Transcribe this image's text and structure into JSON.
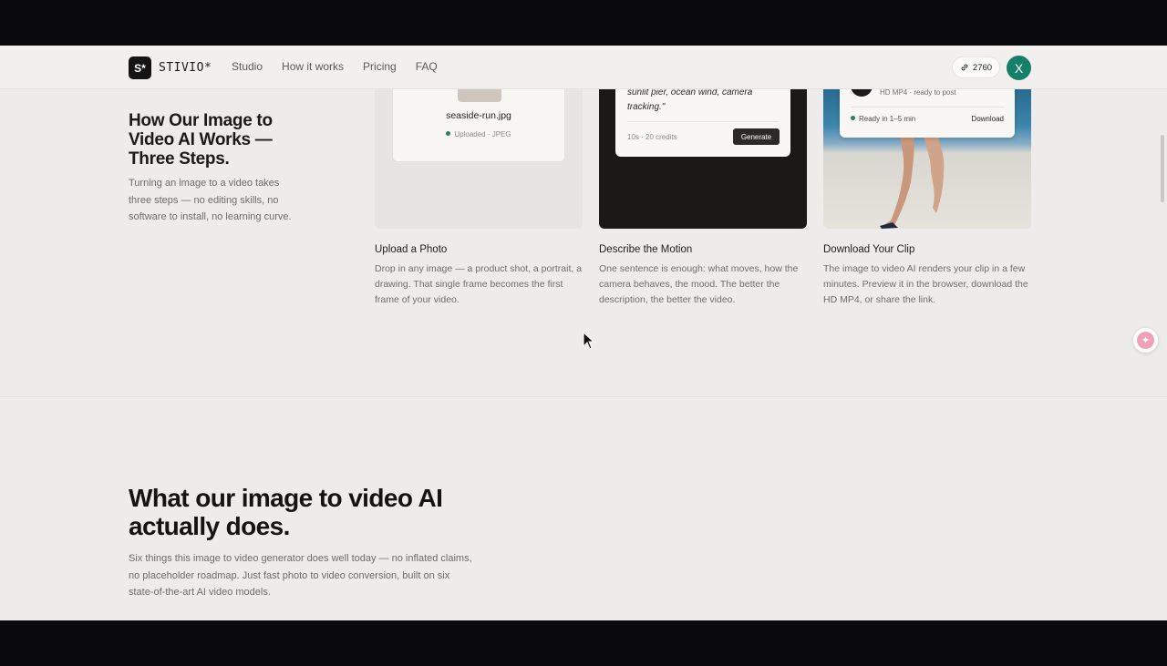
{
  "brand": {
    "logo_mark": "S*",
    "name": "STIVIO*"
  },
  "nav": {
    "links": [
      "Studio",
      "How it works",
      "Pricing",
      "FAQ"
    ]
  },
  "account": {
    "credits": "2760",
    "avatar_initial": "X",
    "avatar_color": "#157f68"
  },
  "how": {
    "title": "How Our Image to Video AI Works — Three Steps.",
    "description": "Turning an image to a video takes three steps — no editing skills, no software to install, no learning curve."
  },
  "cards": {
    "upload": {
      "file_name": "seaside-run.jpg",
      "status": "Uploaded · JPEG"
    },
    "describe": {
      "prompt": "sunlit pier, ocean wind, camera tracking.\"",
      "meta": "10s · 20 credits",
      "button": "Generate"
    },
    "download": {
      "format": "HD MP4 · ready to post",
      "ready": "Ready in 1–5 min",
      "button": "Download"
    }
  },
  "steps": [
    {
      "title": "Upload a Photo",
      "description": "Drop in any image — a product shot, a portrait, a drawing. That single frame becomes the first frame of your video."
    },
    {
      "title": "Describe the Motion",
      "description": "One sentence is enough: what moves, how the camera behaves, the mood. The better the description, the better the video."
    },
    {
      "title": "Download Your Clip",
      "description": "The image to video AI renders your clip in a few minutes. Preview it in the browser, download the HD MP4, or share the link."
    }
  ],
  "features": {
    "title": "What our image to video AI actually does.",
    "description": "Six things this image to video generator does well today — no inflated claims, no placeholder roadmap. Just fast photo to video conversion, built on six state-of-the-art AI video models."
  },
  "icons": {
    "credits": "link-icon",
    "floating": "sparkle-icon",
    "cursor": "cursor-icon"
  }
}
